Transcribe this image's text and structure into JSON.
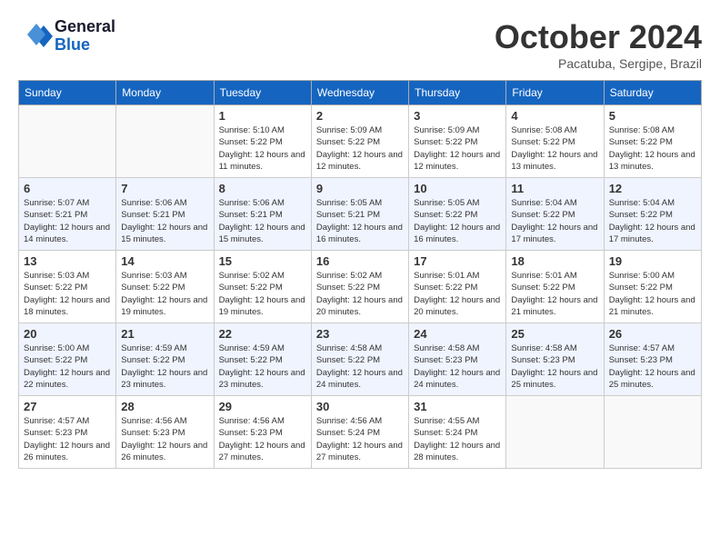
{
  "header": {
    "logo_line1": "General",
    "logo_line2": "Blue",
    "month": "October 2024",
    "location": "Pacatuba, Sergipe, Brazil"
  },
  "days_of_week": [
    "Sunday",
    "Monday",
    "Tuesday",
    "Wednesday",
    "Thursday",
    "Friday",
    "Saturday"
  ],
  "weeks": [
    [
      {
        "day": "",
        "sunrise": "",
        "sunset": "",
        "daylight": ""
      },
      {
        "day": "",
        "sunrise": "",
        "sunset": "",
        "daylight": ""
      },
      {
        "day": "1",
        "sunrise": "Sunrise: 5:10 AM",
        "sunset": "Sunset: 5:22 PM",
        "daylight": "Daylight: 12 hours and 11 minutes."
      },
      {
        "day": "2",
        "sunrise": "Sunrise: 5:09 AM",
        "sunset": "Sunset: 5:22 PM",
        "daylight": "Daylight: 12 hours and 12 minutes."
      },
      {
        "day": "3",
        "sunrise": "Sunrise: 5:09 AM",
        "sunset": "Sunset: 5:22 PM",
        "daylight": "Daylight: 12 hours and 12 minutes."
      },
      {
        "day": "4",
        "sunrise": "Sunrise: 5:08 AM",
        "sunset": "Sunset: 5:22 PM",
        "daylight": "Daylight: 12 hours and 13 minutes."
      },
      {
        "day": "5",
        "sunrise": "Sunrise: 5:08 AM",
        "sunset": "Sunset: 5:22 PM",
        "daylight": "Daylight: 12 hours and 13 minutes."
      }
    ],
    [
      {
        "day": "6",
        "sunrise": "Sunrise: 5:07 AM",
        "sunset": "Sunset: 5:21 PM",
        "daylight": "Daylight: 12 hours and 14 minutes."
      },
      {
        "day": "7",
        "sunrise": "Sunrise: 5:06 AM",
        "sunset": "Sunset: 5:21 PM",
        "daylight": "Daylight: 12 hours and 15 minutes."
      },
      {
        "day": "8",
        "sunrise": "Sunrise: 5:06 AM",
        "sunset": "Sunset: 5:21 PM",
        "daylight": "Daylight: 12 hours and 15 minutes."
      },
      {
        "day": "9",
        "sunrise": "Sunrise: 5:05 AM",
        "sunset": "Sunset: 5:21 PM",
        "daylight": "Daylight: 12 hours and 16 minutes."
      },
      {
        "day": "10",
        "sunrise": "Sunrise: 5:05 AM",
        "sunset": "Sunset: 5:22 PM",
        "daylight": "Daylight: 12 hours and 16 minutes."
      },
      {
        "day": "11",
        "sunrise": "Sunrise: 5:04 AM",
        "sunset": "Sunset: 5:22 PM",
        "daylight": "Daylight: 12 hours and 17 minutes."
      },
      {
        "day": "12",
        "sunrise": "Sunrise: 5:04 AM",
        "sunset": "Sunset: 5:22 PM",
        "daylight": "Daylight: 12 hours and 17 minutes."
      }
    ],
    [
      {
        "day": "13",
        "sunrise": "Sunrise: 5:03 AM",
        "sunset": "Sunset: 5:22 PM",
        "daylight": "Daylight: 12 hours and 18 minutes."
      },
      {
        "day": "14",
        "sunrise": "Sunrise: 5:03 AM",
        "sunset": "Sunset: 5:22 PM",
        "daylight": "Daylight: 12 hours and 19 minutes."
      },
      {
        "day": "15",
        "sunrise": "Sunrise: 5:02 AM",
        "sunset": "Sunset: 5:22 PM",
        "daylight": "Daylight: 12 hours and 19 minutes."
      },
      {
        "day": "16",
        "sunrise": "Sunrise: 5:02 AM",
        "sunset": "Sunset: 5:22 PM",
        "daylight": "Daylight: 12 hours and 20 minutes."
      },
      {
        "day": "17",
        "sunrise": "Sunrise: 5:01 AM",
        "sunset": "Sunset: 5:22 PM",
        "daylight": "Daylight: 12 hours and 20 minutes."
      },
      {
        "day": "18",
        "sunrise": "Sunrise: 5:01 AM",
        "sunset": "Sunset: 5:22 PM",
        "daylight": "Daylight: 12 hours and 21 minutes."
      },
      {
        "day": "19",
        "sunrise": "Sunrise: 5:00 AM",
        "sunset": "Sunset: 5:22 PM",
        "daylight": "Daylight: 12 hours and 21 minutes."
      }
    ],
    [
      {
        "day": "20",
        "sunrise": "Sunrise: 5:00 AM",
        "sunset": "Sunset: 5:22 PM",
        "daylight": "Daylight: 12 hours and 22 minutes."
      },
      {
        "day": "21",
        "sunrise": "Sunrise: 4:59 AM",
        "sunset": "Sunset: 5:22 PM",
        "daylight": "Daylight: 12 hours and 23 minutes."
      },
      {
        "day": "22",
        "sunrise": "Sunrise: 4:59 AM",
        "sunset": "Sunset: 5:22 PM",
        "daylight": "Daylight: 12 hours and 23 minutes."
      },
      {
        "day": "23",
        "sunrise": "Sunrise: 4:58 AM",
        "sunset": "Sunset: 5:22 PM",
        "daylight": "Daylight: 12 hours and 24 minutes."
      },
      {
        "day": "24",
        "sunrise": "Sunrise: 4:58 AM",
        "sunset": "Sunset: 5:23 PM",
        "daylight": "Daylight: 12 hours and 24 minutes."
      },
      {
        "day": "25",
        "sunrise": "Sunrise: 4:58 AM",
        "sunset": "Sunset: 5:23 PM",
        "daylight": "Daylight: 12 hours and 25 minutes."
      },
      {
        "day": "26",
        "sunrise": "Sunrise: 4:57 AM",
        "sunset": "Sunset: 5:23 PM",
        "daylight": "Daylight: 12 hours and 25 minutes."
      }
    ],
    [
      {
        "day": "27",
        "sunrise": "Sunrise: 4:57 AM",
        "sunset": "Sunset: 5:23 PM",
        "daylight": "Daylight: 12 hours and 26 minutes."
      },
      {
        "day": "28",
        "sunrise": "Sunrise: 4:56 AM",
        "sunset": "Sunset: 5:23 PM",
        "daylight": "Daylight: 12 hours and 26 minutes."
      },
      {
        "day": "29",
        "sunrise": "Sunrise: 4:56 AM",
        "sunset": "Sunset: 5:23 PM",
        "daylight": "Daylight: 12 hours and 27 minutes."
      },
      {
        "day": "30",
        "sunrise": "Sunrise: 4:56 AM",
        "sunset": "Sunset: 5:24 PM",
        "daylight": "Daylight: 12 hours and 27 minutes."
      },
      {
        "day": "31",
        "sunrise": "Sunrise: 4:55 AM",
        "sunset": "Sunset: 5:24 PM",
        "daylight": "Daylight: 12 hours and 28 minutes."
      },
      {
        "day": "",
        "sunrise": "",
        "sunset": "",
        "daylight": ""
      },
      {
        "day": "",
        "sunrise": "",
        "sunset": "",
        "daylight": ""
      }
    ]
  ]
}
